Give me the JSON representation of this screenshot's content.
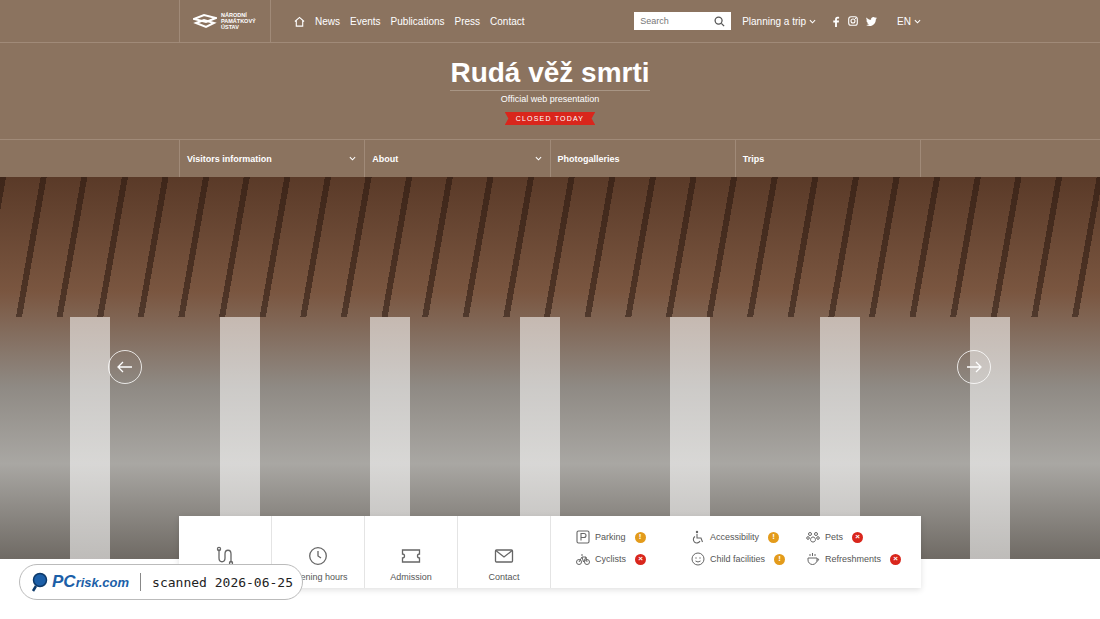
{
  "logo": {
    "lines": [
      "NÁRODNÍ",
      "PAMÁTKOVÝ",
      "ÚSTAV"
    ]
  },
  "nav": [
    "News",
    "Events",
    "Publications",
    "Press",
    "Contact"
  ],
  "search": {
    "placeholder": "Search"
  },
  "planning": {
    "label": "Planning a trip",
    "expandable": true
  },
  "language": {
    "label": "EN",
    "expandable": true
  },
  "title": "Rudá věž smrti",
  "subtitle": "Official web presentation",
  "status_badge": "CLOSED TODAY",
  "subnav": [
    {
      "label": "Visitors information",
      "expandable": true
    },
    {
      "label": "About",
      "expandable": true
    },
    {
      "label": "Photogalleries",
      "expandable": false
    },
    {
      "label": "Trips",
      "expandable": false
    }
  ],
  "quick_links": [
    {
      "label": "Tours",
      "kind": "tours"
    },
    {
      "label": "Opening hours",
      "kind": "clock"
    },
    {
      "label": "Admission",
      "kind": "ticket"
    },
    {
      "label": "Contact",
      "kind": "mail"
    }
  ],
  "amenities": [
    {
      "label": "Parking",
      "kind": "parking",
      "mark": "!",
      "color": "#e39b1b"
    },
    {
      "label": "Accessibility",
      "kind": "wheelchair",
      "mark": "!",
      "color": "#e39b1b"
    },
    {
      "label": "Pets",
      "kind": "paw",
      "mark": "×",
      "color": "#d9261c"
    },
    {
      "label": "Cyclists",
      "kind": "bike",
      "mark": "×",
      "color": "#d9261c"
    },
    {
      "label": "Child facilities",
      "kind": "child",
      "mark": "!",
      "color": "#e39b1b"
    },
    {
      "label": "Refreshments",
      "kind": "cup",
      "mark": "×",
      "color": "#d9261c"
    }
  ],
  "watermark": {
    "brand_prefix": "PC",
    "brand_suffix": "risk.com",
    "text": "scanned 2026-06-25"
  }
}
